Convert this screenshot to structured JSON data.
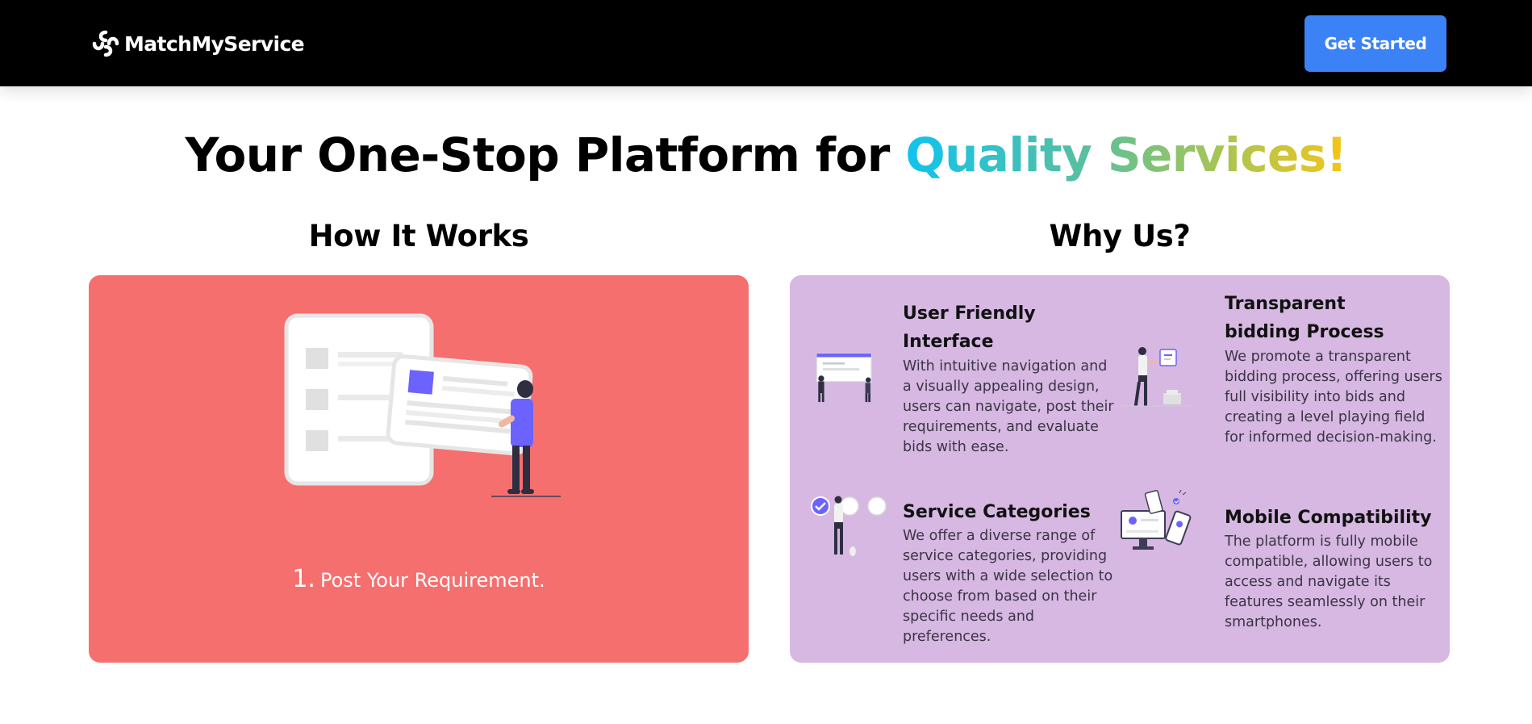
{
  "navbar": {
    "brand_name": "MatchMyService",
    "cta_label": "Get Started"
  },
  "hero": {
    "title_plain": "Your One-Stop Platform for ",
    "title_highlight": "Quality Services!"
  },
  "how_it_works": {
    "title": "How It Works",
    "step_number": "1.",
    "step_text": "Post Your Requirement.",
    "card_color": "#f66f6f"
  },
  "why_us": {
    "title": "Why Us?",
    "card_color": "#d6b8e2",
    "features": [
      {
        "title": "User Friendly Interface",
        "description": "With intuitive navigation and a visually appealing design, users can navigate, post their requirements, and evaluate bids with ease.",
        "icon": "presentation-board-icon"
      },
      {
        "title": "Transparent bidding Process",
        "description": "We promote a transparent bidding process, offering users full visibility into bids and creating a level playing field for informed decision-making.",
        "icon": "bidding-board-icon"
      },
      {
        "title": "Service Categories",
        "description": "We offer a diverse range of service categories, providing users with a wide selection to choose from based on their specific needs and preferences.",
        "icon": "category-selection-icon"
      },
      {
        "title": "Mobile Compatibility",
        "description": "The platform is fully mobile compatible, allowing users to access and navigate its features seamlessly on their smartphones.",
        "icon": "mobile-devices-icon"
      }
    ]
  },
  "colors": {
    "accent": "#3b82f6",
    "navbar": "#000000",
    "illustration_purple": "#6c63ff"
  }
}
